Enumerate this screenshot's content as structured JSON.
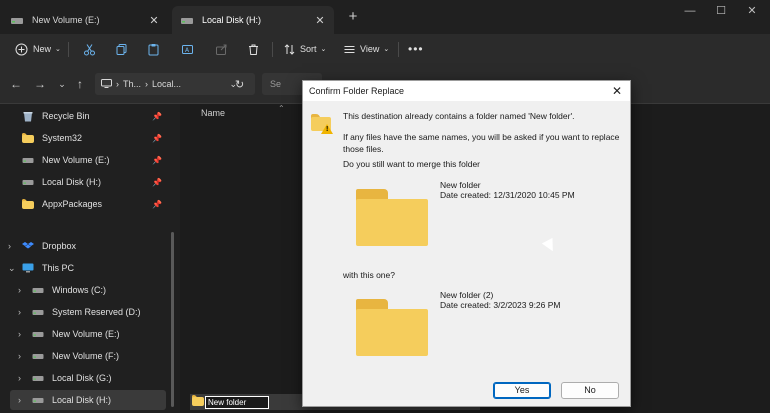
{
  "tabs": [
    {
      "label": "New Volume (E:)"
    },
    {
      "label": "Local Disk (H:)"
    }
  ],
  "toolbar": {
    "new_label": "New",
    "sort_label": "Sort",
    "view_label": "View"
  },
  "address": {
    "path_part1": "Th...",
    "path_part2": "Local...",
    "search_placeholder": "Se"
  },
  "sidebar": {
    "items": [
      {
        "label": "Recycle Bin",
        "icon": "recycle-bin-icon",
        "pinned": true
      },
      {
        "label": "System32",
        "icon": "folder-icon",
        "pinned": true
      },
      {
        "label": "New Volume (E:)",
        "icon": "drive-icon",
        "pinned": true
      },
      {
        "label": "Local Disk (H:)",
        "icon": "drive-icon",
        "pinned": true
      },
      {
        "label": "AppxPackages",
        "icon": "folder-icon",
        "pinned": true
      },
      {
        "label": "Dropbox",
        "icon": "dropbox-icon"
      },
      {
        "label": "This PC",
        "icon": "computer-icon",
        "expanded": true
      },
      {
        "label": "Windows (C:)",
        "icon": "drive-icon"
      },
      {
        "label": "System Reserved (D:)",
        "icon": "drive-icon"
      },
      {
        "label": "New Volume (E:)",
        "icon": "drive-icon"
      },
      {
        "label": "New Volume (F:)",
        "icon": "drive-icon"
      },
      {
        "label": "Local Disk (G:)",
        "icon": "drive-icon"
      },
      {
        "label": "Local Disk (H:)",
        "icon": "drive-icon",
        "selected": true
      }
    ]
  },
  "content": {
    "column_name": "Name",
    "rename_value": "New folder"
  },
  "dialog": {
    "title": "Confirm Folder Replace",
    "message": "This destination already contains a folder named 'New folder'.",
    "detail": "If any files have the same names, you will be asked if you want to replace those files.",
    "question": "Do you still want to merge this folder",
    "existing_name": "New folder",
    "existing_date": "Date created: 12/31/2020 10:45 PM",
    "with_text": "with this one?",
    "incoming_name": "New folder (2)",
    "incoming_date": "Date created: 3/2/2023 9:26 PM",
    "yes_label": "Yes",
    "no_label": "No"
  },
  "colors": {
    "accent": "#0067c0",
    "folder": "#f5cd5c",
    "dark_bg": "#1c1c1c"
  }
}
